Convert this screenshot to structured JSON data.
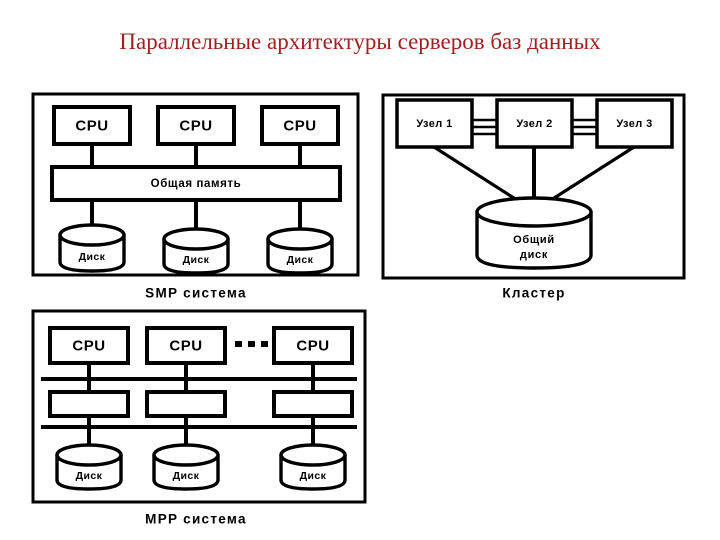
{
  "slide": {
    "title": "Параллельные архитектуры серверов баз данных",
    "title_color": "#a02020",
    "background_color": "#ffffff",
    "line_color": "#000000"
  },
  "diagrams": [
    {
      "id": "smp",
      "caption": "SMP система",
      "cpus": [
        "CPU",
        "CPU",
        "CPU"
      ],
      "memory_label": "Общая память",
      "disks": [
        "Диск",
        "Диск",
        "Диск"
      ]
    },
    {
      "id": "cluster",
      "caption": "Кластер",
      "nodes": [
        "Узел 1",
        "Узел 2",
        "Узел 3"
      ],
      "shared_disk_line1": "Общий",
      "shared_disk_line2": "диск"
    },
    {
      "id": "mpp",
      "caption": "MPP система",
      "cpus": [
        "CPU",
        "CPU",
        "CPU"
      ],
      "ellipsis": "• • •",
      "memory_labels": [
        "",
        "",
        ""
      ],
      "disks": [
        "Диск",
        "Диск",
        "Диск"
      ]
    }
  ]
}
